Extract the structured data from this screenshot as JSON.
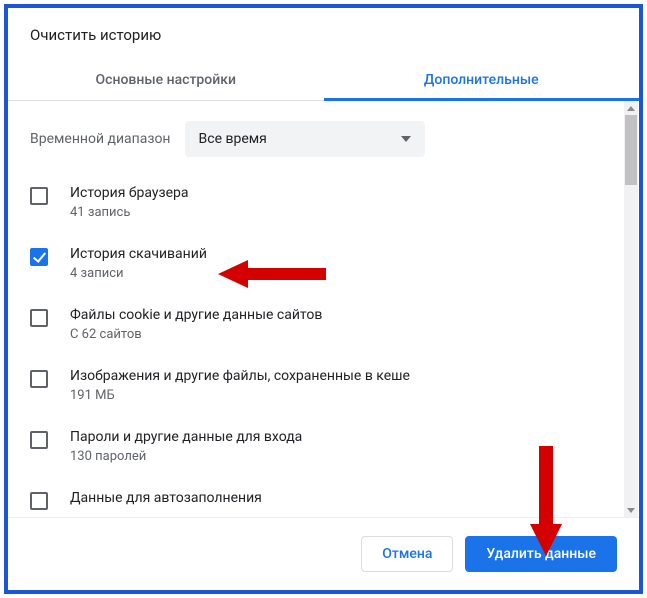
{
  "dialog": {
    "title": "Очистить историю",
    "tabs": {
      "basic": "Основные настройки",
      "advanced": "Дополнительные"
    },
    "range": {
      "label": "Временной диапазон",
      "selected": "Все время"
    },
    "options": [
      {
        "title": "История браузера",
        "sub": "41 запись",
        "checked": false
      },
      {
        "title": "История скачиваний",
        "sub": "4 записи",
        "checked": true
      },
      {
        "title": "Файлы cookie и другие данные сайтов",
        "sub": "С 62 сайтов",
        "checked": false
      },
      {
        "title": "Изображения и другие файлы, сохраненные в кеше",
        "sub": "191 МБ",
        "checked": false
      },
      {
        "title": "Пароли и другие данные для входа",
        "sub": "130 паролей",
        "checked": false
      },
      {
        "title": "Данные для автозаполнения",
        "sub": "",
        "checked": false
      }
    ],
    "footer": {
      "cancel": "Отмена",
      "confirm": "Удалить данные"
    }
  }
}
